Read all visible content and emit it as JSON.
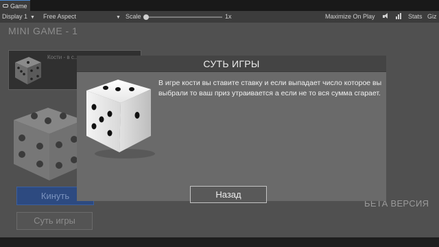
{
  "window": {
    "tab_label": "Game",
    "display": "Display 1",
    "aspect": "Free Aspect",
    "scale_label": "Scale",
    "scale_value": "1x",
    "maximize": "Maximize On Play",
    "stats": "Stats",
    "gizmos": "Giz"
  },
  "game": {
    "title": "MINI GAME - 1",
    "info_text": "Кости - в с... выиграть и...",
    "roll_button": "Кинуть",
    "rules_button": "Суть игры",
    "beta_label": "БЕТА ВЕРСИЯ"
  },
  "modal": {
    "title": "СУТЬ ИГРЫ",
    "description": "В игре кости вы ставите ставку и если выпадает число которое вы выбрали то ваш приз утраивается а если не то вся сумма сгарает.",
    "back_button": "Назад"
  },
  "icons": [
    "game-view-icon",
    "dropdown-caret-icon",
    "mute-audio-icon",
    "stats-icon",
    "dice-icon"
  ]
}
